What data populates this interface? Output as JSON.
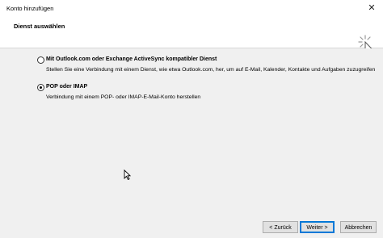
{
  "window": {
    "title": "Konto hinzufügen",
    "close_glyph": "✕"
  },
  "header": {
    "title": "Dienst auswählen",
    "icon": "sparkle-cursor-icon"
  },
  "options": [
    {
      "label": "Mit Outlook.com oder Exchange ActiveSync kompatibler Dienst",
      "description": "Stellen Sie eine Verbindung mit einem Dienst, wie etwa Outlook.com, her, um auf E-Mail, Kalender, Kontakte und Aufgaben zuzugreifen",
      "selected": false
    },
    {
      "label": "POP oder IMAP",
      "description": "Verbindung mit einem POP- oder IMAP-E-Mail-Konto herstellen",
      "selected": true
    }
  ],
  "buttons": {
    "back": "< Zurück",
    "next": "Weiter >",
    "cancel": "Abbrechen"
  },
  "colors": {
    "dialog_bg": "#f0f0f0",
    "button_bg": "#e1e1e1",
    "accent": "#0078d7"
  }
}
